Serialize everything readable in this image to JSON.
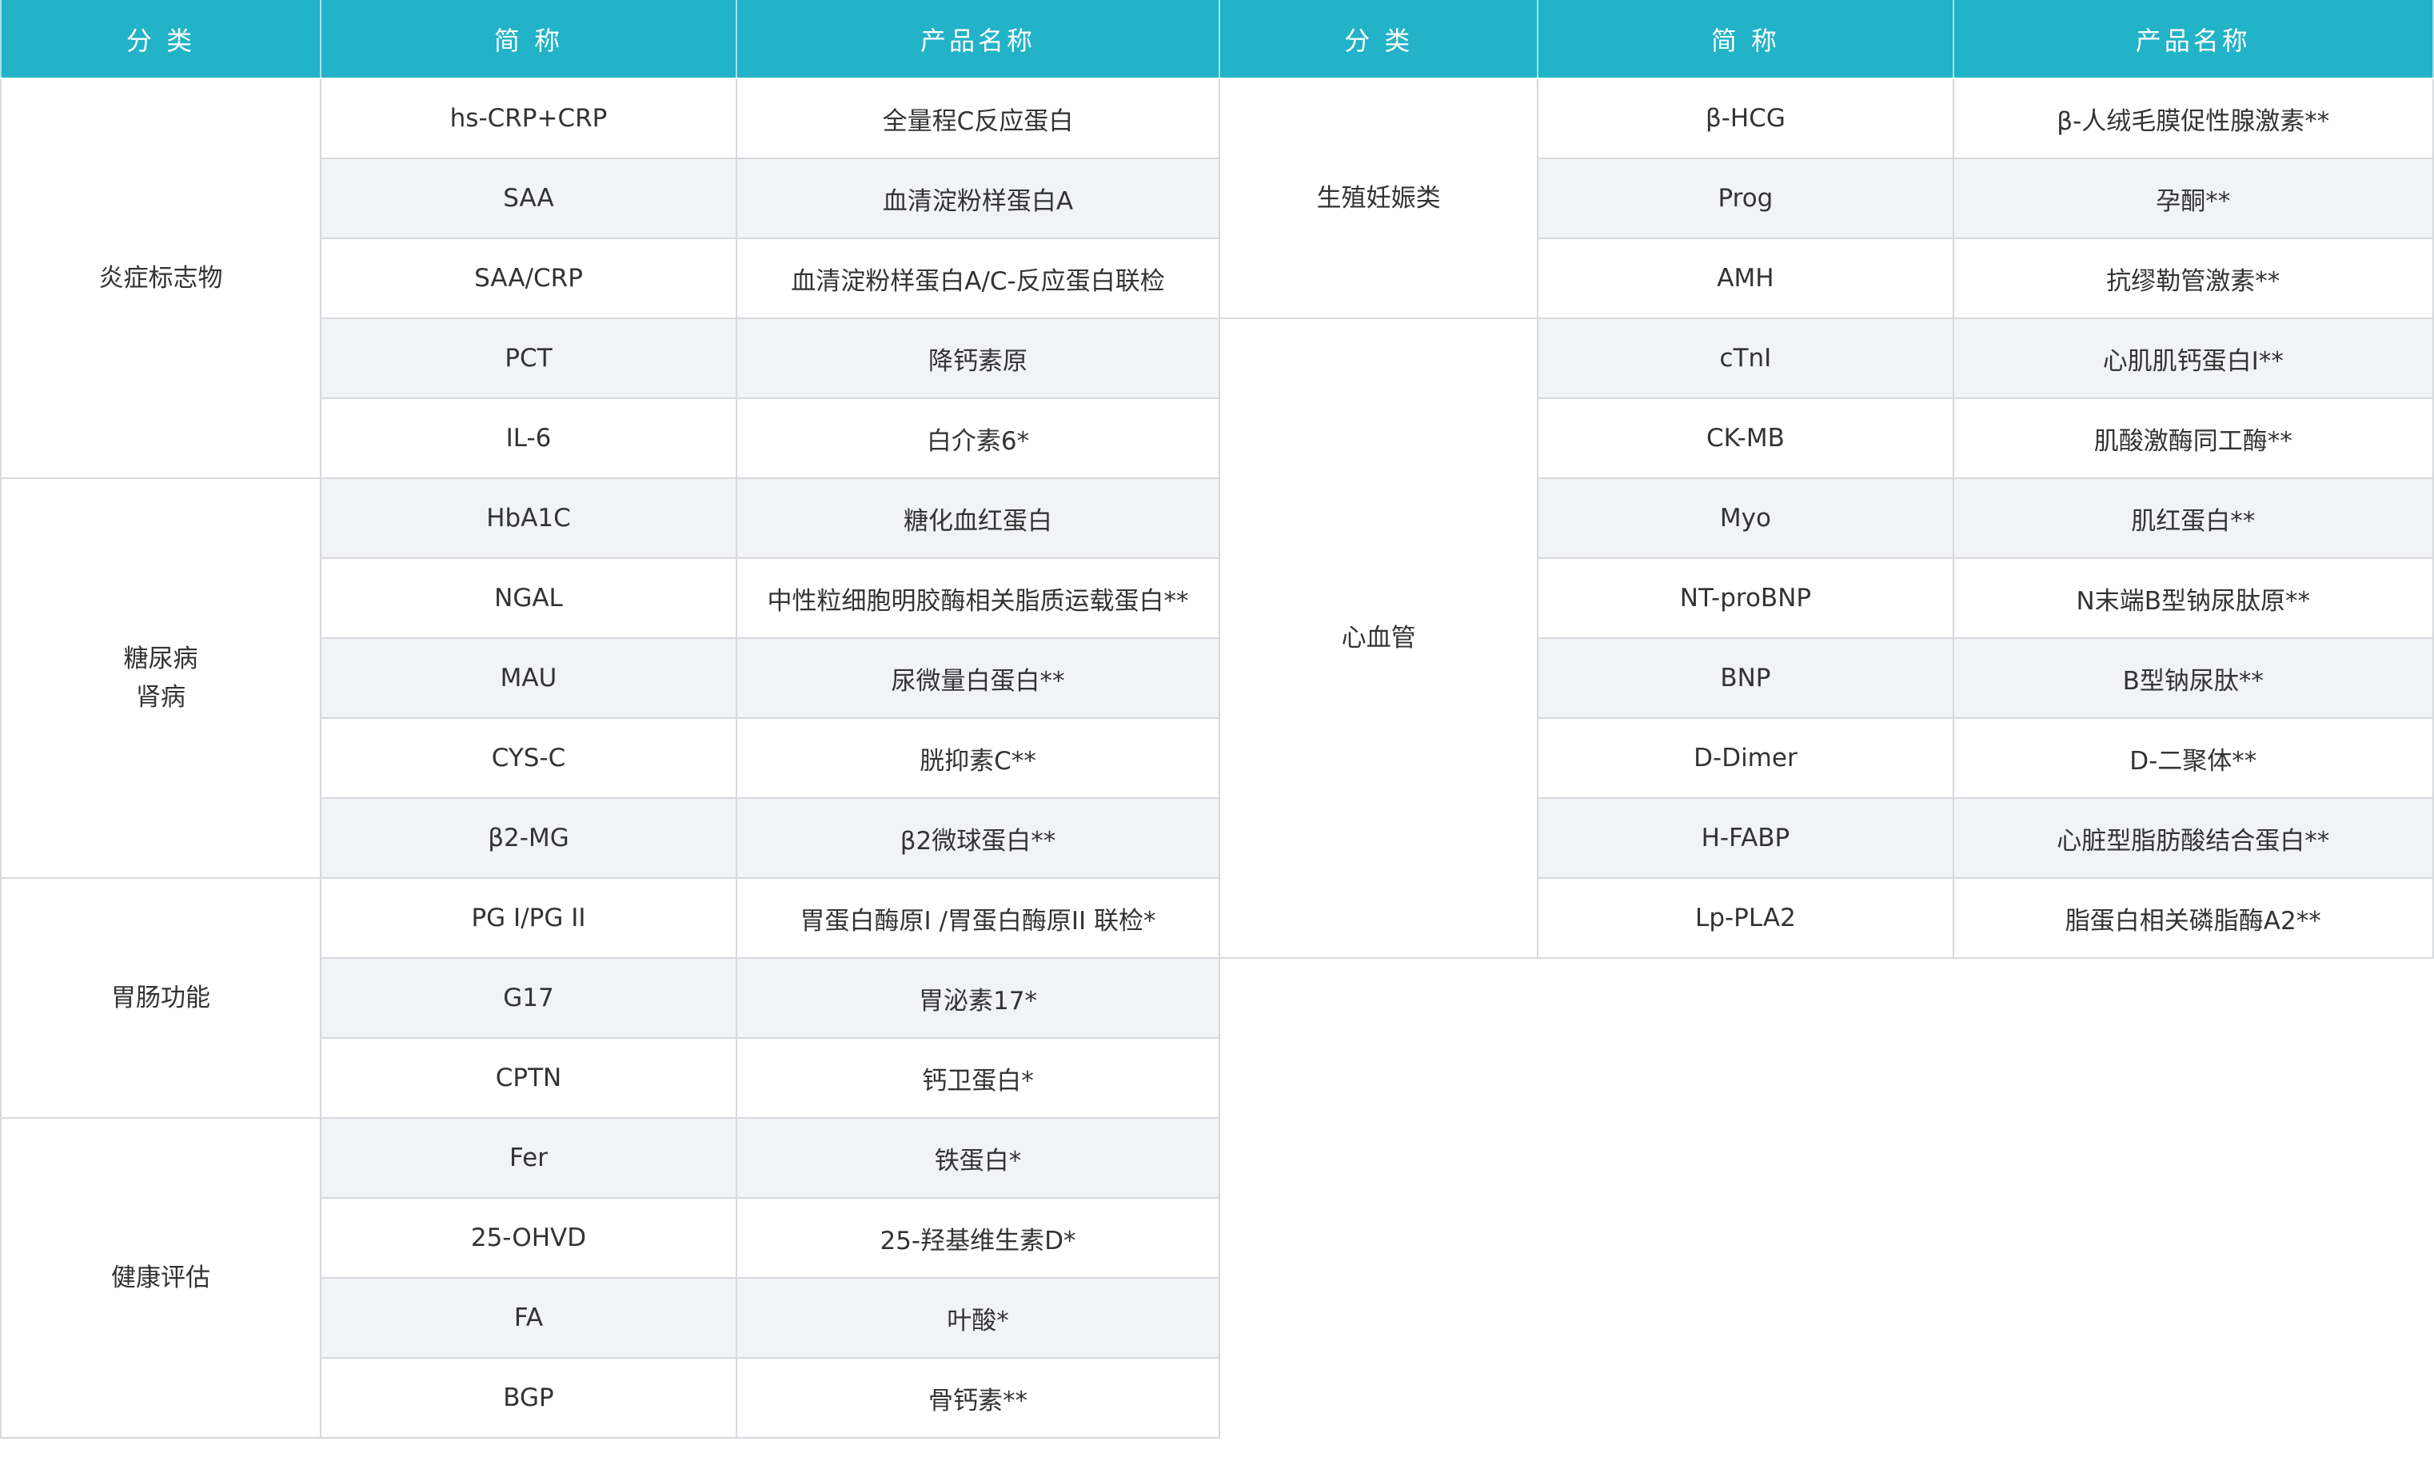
{
  "left_table": {
    "headers": [
      "分 类",
      "简 称",
      "产品名称"
    ],
    "groups": [
      {
        "category": "炎症标志物",
        "rows": [
          {
            "abbr": "hs-CRP+CRP",
            "name": "全量程C反应蛋白"
          },
          {
            "abbr": "SAA",
            "name": "血清淀粉样蛋白A"
          },
          {
            "abbr": "SAA/CRP",
            "name": "血清淀粉样蛋白A/C-反应蛋白联检"
          },
          {
            "abbr": "PCT",
            "name": "降钙素原"
          },
          {
            "abbr": "IL-6",
            "name": "白介素6*"
          }
        ]
      },
      {
        "category": "糖尿病\n肾病",
        "rows": [
          {
            "abbr": "HbA1C",
            "name": "糖化血红蛋白"
          },
          {
            "abbr": "NGAL",
            "name": "中性粒细胞明胶酶相关脂质运载蛋白**"
          },
          {
            "abbr": "MAU",
            "name": "尿微量白蛋白**"
          },
          {
            "abbr": "CYS-C",
            "name": "胱抑素C**"
          },
          {
            "abbr": "β2-MG",
            "name": "β2微球蛋白**"
          }
        ]
      },
      {
        "category": "胃肠功能",
        "rows": [
          {
            "abbr": "PG I/PG II",
            "name": "胃蛋白酶原I /胃蛋白酶原II 联检*"
          },
          {
            "abbr": "G17",
            "name": "胃泌素17*"
          },
          {
            "abbr": "CPTN",
            "name": "钙卫蛋白*"
          }
        ]
      },
      {
        "category": "健康评估",
        "rows": [
          {
            "abbr": "Fer",
            "name": "铁蛋白*"
          },
          {
            "abbr": "25-OHVD",
            "name": "25-羟基维生素D*"
          },
          {
            "abbr": "FA",
            "name": "叶酸*"
          },
          {
            "abbr": "BGP",
            "name": "骨钙素**"
          }
        ]
      }
    ]
  },
  "right_table": {
    "headers": [
      "分 类",
      "简 称",
      "产品名称"
    ],
    "groups": [
      {
        "category": "生殖妊娠类",
        "rows": [
          {
            "abbr": "β-HCG",
            "name": "β-人绒毛膜促性腺激素**"
          },
          {
            "abbr": "Prog",
            "name": "孕酮**"
          },
          {
            "abbr": "AMH",
            "name": "抗缪勒管激素**"
          }
        ]
      },
      {
        "category": "心血管",
        "rows": [
          {
            "abbr": "cTnI",
            "name": "心肌肌钙蛋白I**"
          },
          {
            "abbr": "CK-MB",
            "name": "肌酸激酶同工酶**"
          },
          {
            "abbr": "Myo",
            "name": "肌红蛋白**"
          },
          {
            "abbr": "NT-proBNP",
            "name": "N末端B型钠尿肽原**"
          },
          {
            "abbr": "BNP",
            "name": "B型钠尿肽**"
          },
          {
            "abbr": "D-Dimer",
            "name": "D-二聚体**"
          },
          {
            "abbr": "H-FABP",
            "name": "心脏型脂肪酸结合蛋白**"
          },
          {
            "abbr": "Lp-PLA2",
            "name": "脂蛋白相关磷脂酶A2**"
          }
        ]
      }
    ]
  },
  "colors": {
    "header_bg": "#22b3c8",
    "header_text": "#ffffff",
    "row_shade": "#f2f3f7",
    "border": "#d7d9dd",
    "text": "#333333"
  }
}
